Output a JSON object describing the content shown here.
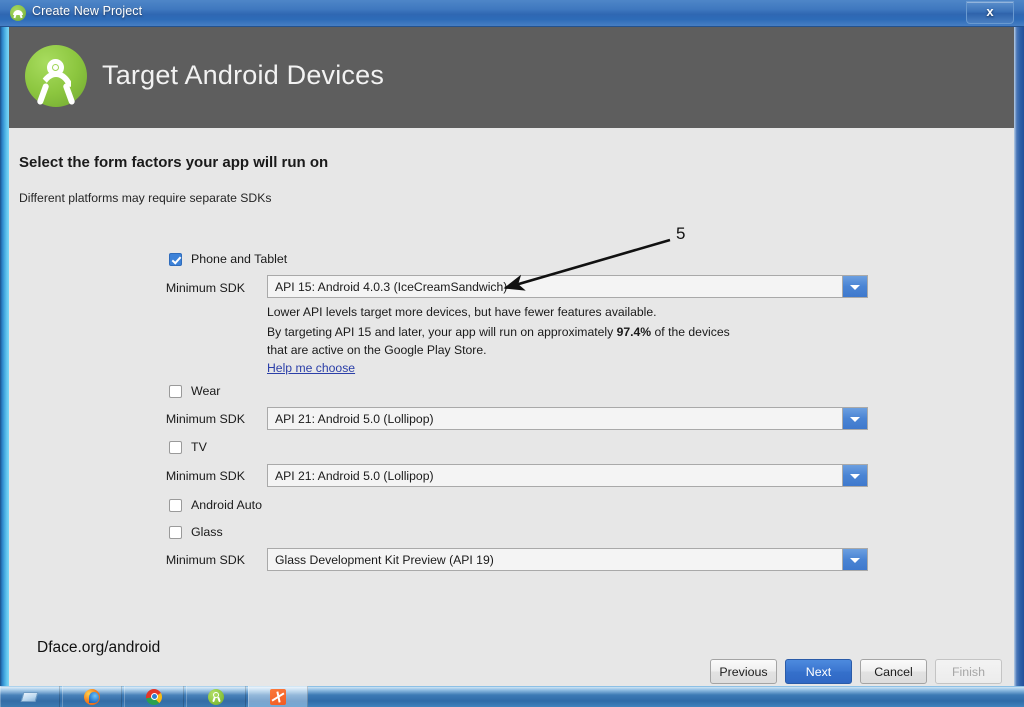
{
  "window": {
    "title": "Create New Project",
    "close_label": "x",
    "app_icon": "android-icon"
  },
  "wizard": {
    "header_title": "Target Android Devices",
    "logo": "android-studio-logo",
    "page_heading": "Select the form factors your app will run on",
    "page_subtitle": "Different platforms may require separate SDKs"
  },
  "form": {
    "sdk_label": "Minimum SDK",
    "factors": [
      {
        "name": "phone-tablet",
        "label": "Phone and Tablet",
        "checked": true,
        "sdk_value": "API 15: Android 4.0.3 (IceCreamSandwich)"
      },
      {
        "name": "wear",
        "label": "Wear",
        "checked": false,
        "sdk_value": "API 21: Android 5.0 (Lollipop)"
      },
      {
        "name": "tv",
        "label": "TV",
        "checked": false,
        "sdk_value": "API 21: Android 5.0 (Lollipop)"
      },
      {
        "name": "android-auto",
        "label": "Android Auto",
        "checked": false,
        "sdk_value": null
      },
      {
        "name": "glass",
        "label": "Glass",
        "checked": false,
        "sdk_value": "Glass Development Kit Preview (API 19)"
      }
    ],
    "hint_line1": "Lower API levels target more devices, but have fewer features available.",
    "hint_line2_pre": "By targeting API 15 and later, your app will run on approximately ",
    "hint_line2_bold": "97.4%",
    "hint_line2_post": " of the devices",
    "hint_line3": "that are active on the Google Play Store.",
    "help_link": "Help me choose"
  },
  "annotation": {
    "number": "5"
  },
  "watermark": {
    "text": "Dface.org/android"
  },
  "footer": {
    "buttons": [
      {
        "name": "previous",
        "label": "Previous",
        "style": "normal"
      },
      {
        "name": "next",
        "label": "Next",
        "style": "primary"
      },
      {
        "name": "cancel",
        "label": "Cancel",
        "style": "normal"
      },
      {
        "name": "finish",
        "label": "Finish",
        "style": "disabled"
      }
    ]
  },
  "taskbar": {
    "items": [
      {
        "name": "windows-explorer",
        "icon": "explorer-icon",
        "active": false
      },
      {
        "name": "firefox",
        "icon": "firefox-icon",
        "active": false
      },
      {
        "name": "google-chrome",
        "icon": "chrome-icon",
        "active": false
      },
      {
        "name": "android-studio",
        "icon": "android-studio-icon",
        "active": false
      },
      {
        "name": "orange-tool",
        "icon": "orange-tool-icon",
        "active": true
      }
    ]
  },
  "colors": {
    "header_bg": "#5e5e5e",
    "body_bg": "#e7e7e7",
    "accent_blue": "#3b76d0",
    "android_green": "#8cc63f",
    "link": "#2b3fa8"
  }
}
